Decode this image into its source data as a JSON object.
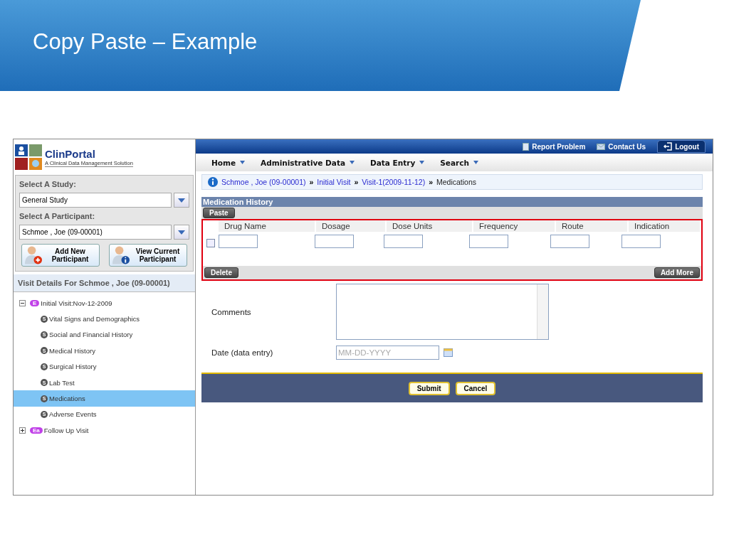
{
  "slide": {
    "title": "Copy Paste – Example"
  },
  "app": {
    "logo": {
      "name": "ClinPortal",
      "tagline": "A Clinical Data Management Solution"
    },
    "top_links": [
      {
        "label": "Report Problem",
        "kind": "report"
      },
      {
        "label": "Contact Us",
        "kind": "mail"
      },
      {
        "label": "Logout",
        "kind": "logout"
      }
    ],
    "menu": [
      "Home",
      "Administrative Data",
      "Data Entry",
      "Search"
    ],
    "sidebar": {
      "study_label": "Select A Study:",
      "study": "General Study",
      "participant_label": "Select A Participant:",
      "participant": "Schmoe , Joe (09-00001)",
      "buttons": [
        {
          "label": "Add New Participant",
          "kind": "add"
        },
        {
          "label": "View Current Participant",
          "kind": "view"
        }
      ],
      "visit_header": "Visit Details For  Schmoe , Joe (09-00001)",
      "tree": [
        {
          "label": "Initial Visit:Nov-12-2009",
          "badge": "E",
          "expanded": true,
          "selected": false,
          "children": [
            {
              "label": "Vital Signs and Demographics",
              "badge": "S",
              "selected": false
            },
            {
              "label": "Social and Financial History",
              "badge": "S",
              "selected": false
            },
            {
              "label": "Medical History",
              "badge": "S",
              "selected": false
            },
            {
              "label": "Surgical History",
              "badge": "S",
              "selected": false
            },
            {
              "label": "Lab Test",
              "badge": "S",
              "selected": false
            },
            {
              "label": "Medications",
              "badge": "S",
              "selected": true
            },
            {
              "label": "Adverse Events",
              "badge": "S",
              "selected": false
            }
          ]
        },
        {
          "label": "Follow Up Visit",
          "badge": "Ea",
          "expanded": false,
          "selected": false
        }
      ]
    },
    "breadcrumb": {
      "separator": "»",
      "items": [
        {
          "label": "Schmoe , Joe (09-00001)",
          "link": true
        },
        {
          "label": "Initial Visit",
          "link": true
        },
        {
          "label": "Visit-1(2009-11-12)",
          "link": true
        },
        {
          "label": "Medications",
          "link": false
        }
      ]
    },
    "medication_history": {
      "title": "Medication History",
      "paste": "Paste",
      "highlighted": true,
      "columns": [
        "Drug Name",
        "Dosage",
        "Dose Units",
        "Frequency",
        "Route",
        "Indication"
      ],
      "rows": [
        {
          "checked": false
        }
      ],
      "delete": "Delete",
      "add_more": "Add More"
    },
    "form": {
      "comments_label": "Comments",
      "date_label": "Date (data entry)",
      "date_placeholder": "MM-DD-YYYY"
    },
    "buttons": [
      "Submit",
      "Cancel"
    ]
  }
}
